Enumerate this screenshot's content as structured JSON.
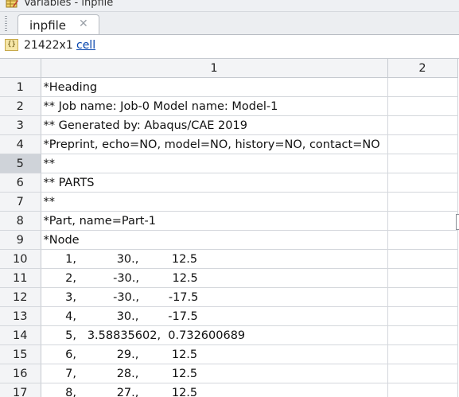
{
  "window": {
    "title": "Variables - inpfile"
  },
  "tab": {
    "label": "inpfile",
    "close": "✕"
  },
  "info": {
    "icon": "{}",
    "dims": "21422x1",
    "type_link": "cell"
  },
  "columns": [
    "1",
    "2"
  ],
  "rows": [
    {
      "n": "1",
      "c1": "*Heading"
    },
    {
      "n": "2",
      "c1": "** Job name: Job-0 Model name: Model-1"
    },
    {
      "n": "3",
      "c1": "** Generated by: Abaqus/CAE 2019"
    },
    {
      "n": "4",
      "c1": "*Preprint, echo=NO, model=NO, history=NO, contact=NO"
    },
    {
      "n": "5",
      "c1": "**"
    },
    {
      "n": "6",
      "c1": "** PARTS"
    },
    {
      "n": "7",
      "c1": "**"
    },
    {
      "n": "8",
      "c1": "*Part, name=Part-1"
    },
    {
      "n": "9",
      "c1": "*Node"
    },
    {
      "n": "10",
      "c1": "      1,           30.,         12.5"
    },
    {
      "n": "11",
      "c1": "      2,          -30.,         12.5"
    },
    {
      "n": "12",
      "c1": "      3,          -30.,        -17.5"
    },
    {
      "n": "13",
      "c1": "      4,           30.,        -17.5"
    },
    {
      "n": "14",
      "c1": "      5,   3.58835602,  0.732600689"
    },
    {
      "n": "15",
      "c1": "      6,           29.,         12.5"
    },
    {
      "n": "16",
      "c1": "      7,           28.,         12.5"
    },
    {
      "n": "17",
      "c1": "      8,           27.,         12.5"
    }
  ],
  "selected_row": "5"
}
